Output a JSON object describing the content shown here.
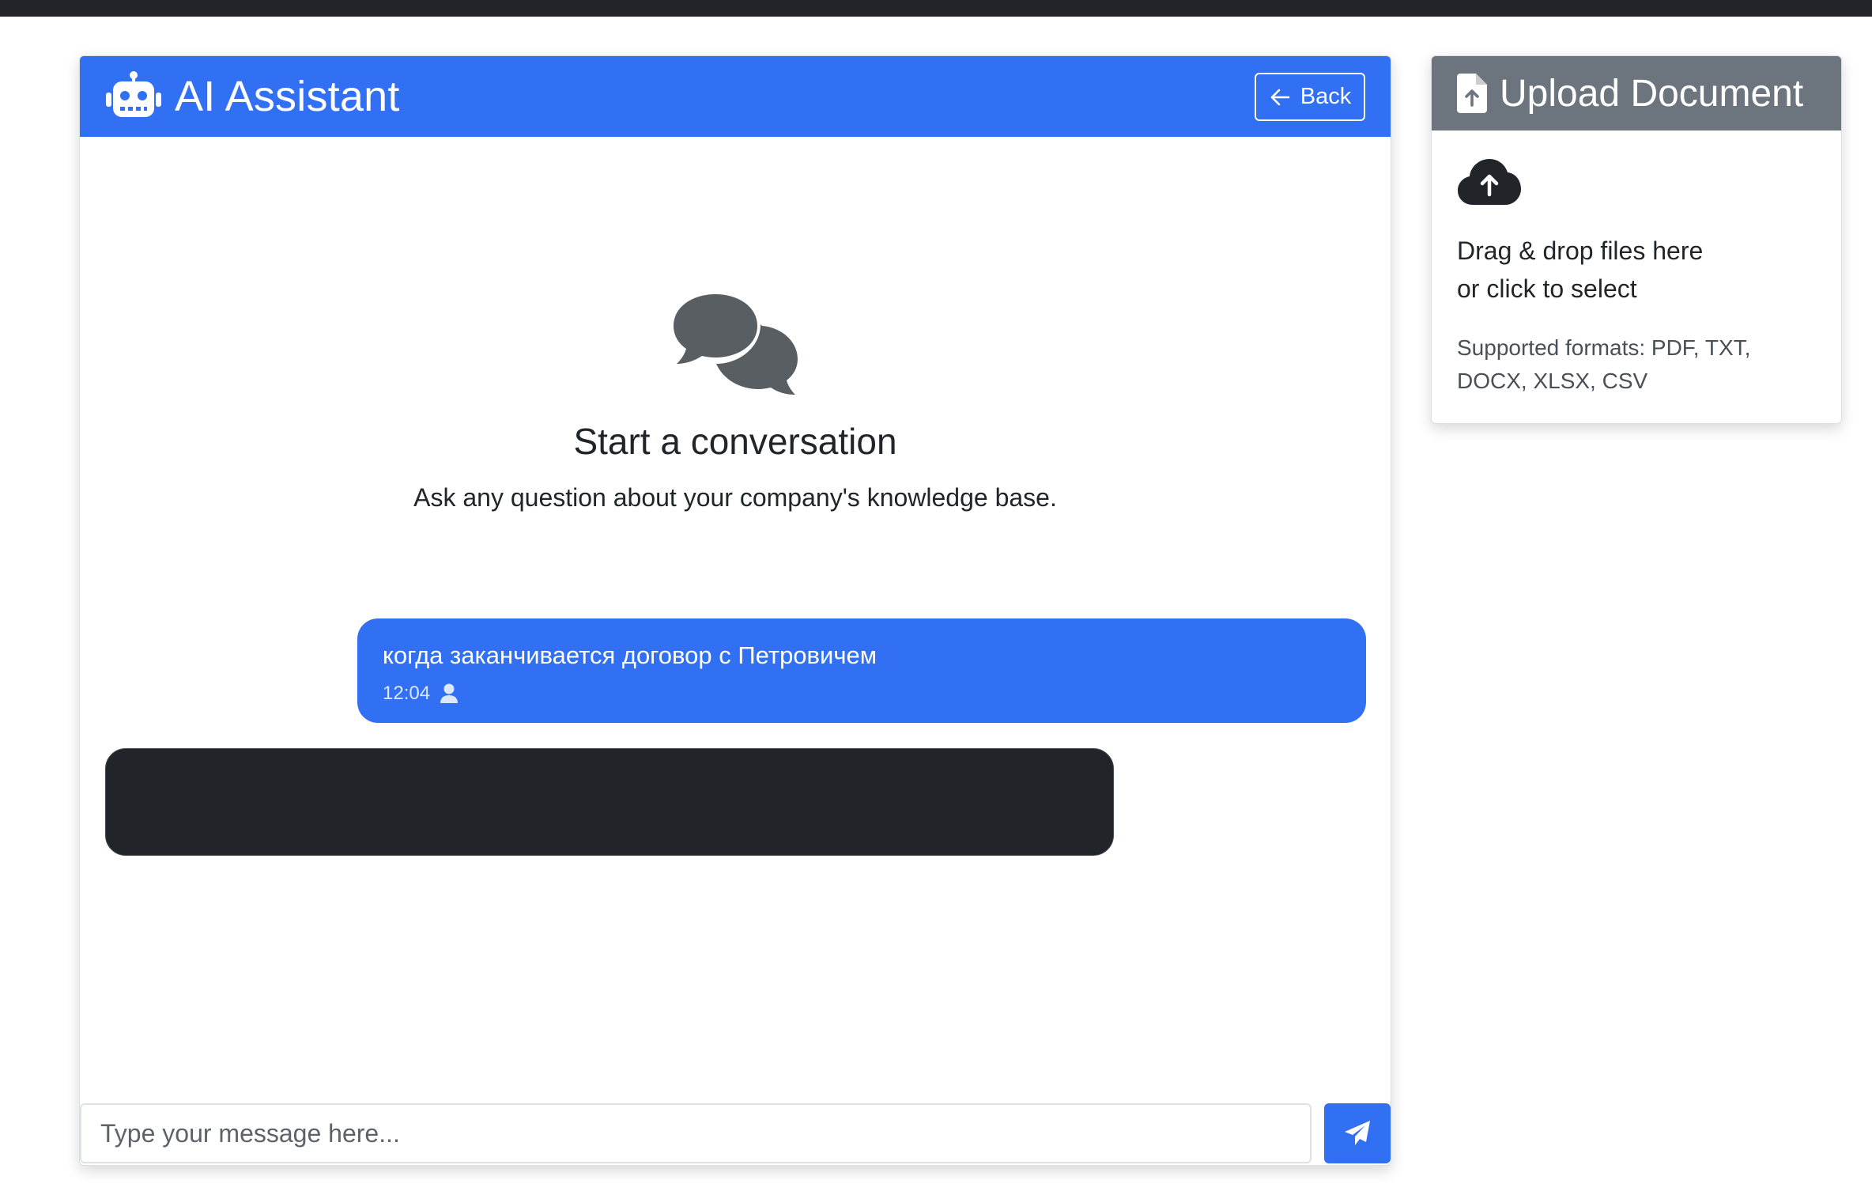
{
  "chat": {
    "title": "AI Assistant",
    "back_label": "Back",
    "empty_title": "Start a conversation",
    "empty_subtitle": "Ask any question about your company's knowledge base.",
    "messages": [
      {
        "role": "user",
        "text": "когда заканчивается договор с Петровичем",
        "time": "12:04"
      }
    ],
    "input_placeholder": "Type your message here..."
  },
  "upload": {
    "title": "Upload Document",
    "drag_line1": "Drag & drop files here",
    "drag_line2": "or click to select",
    "formats_line1": "Supported formats: PDF, TXT,",
    "formats_line2": "DOCX, XLSX, CSV"
  },
  "colors": {
    "accent": "#3170f2",
    "topbar": "#212529",
    "upload_header": "#6c757d",
    "bot_bubble": "#212529"
  },
  "icons": {
    "header": "robot-icon",
    "back": "arrow-left-icon",
    "empty": "chat-bubbles-icon",
    "user": "person-icon",
    "send": "paper-plane-icon",
    "upload_header": "file-upload-icon",
    "upload_body": "cloud-upload-icon"
  }
}
